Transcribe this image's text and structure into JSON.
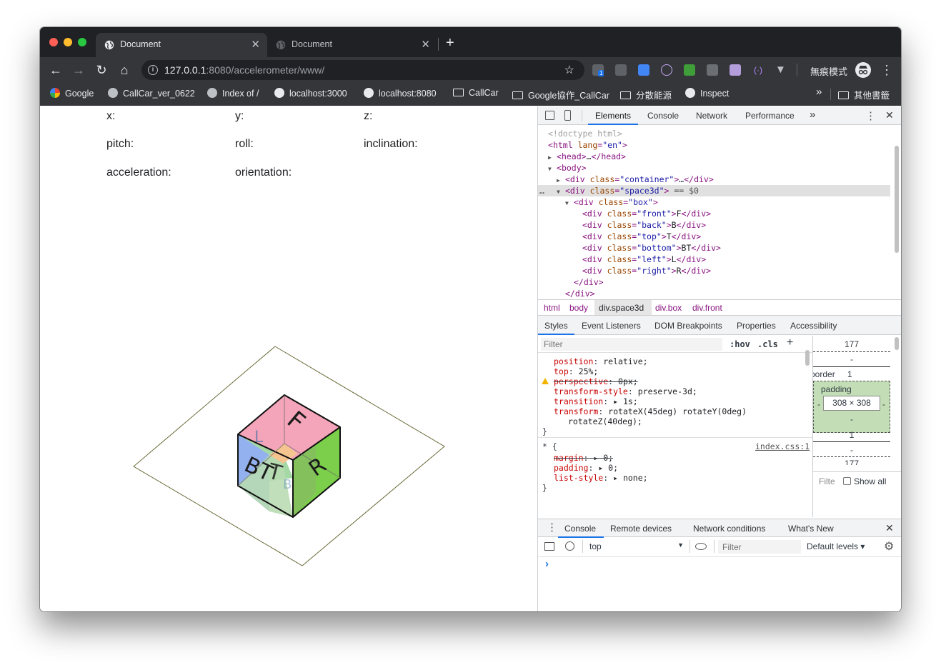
{
  "tabs": [
    {
      "label": "Document",
      "active": true
    },
    {
      "label": "Document",
      "active": false
    }
  ],
  "toolbar": {
    "url_host": "127.0.0.1",
    "url_rest": ":8080/accelerometer/www/",
    "incognito_label": "無痕模式",
    "ext_badge": "1"
  },
  "bookmarks": [
    {
      "label": "Google",
      "icon": "google-icon"
    },
    {
      "label": "CallCar_ver_0622",
      "icon": "site-icon"
    },
    {
      "label": "Index of /",
      "icon": "site-icon"
    },
    {
      "label": "localhost:3000",
      "icon": "globe-icon"
    },
    {
      "label": "localhost:8080",
      "icon": "globe-icon"
    },
    {
      "label": "CallCar",
      "icon": "folder-icon"
    },
    {
      "label": "Google協作_CallCar",
      "icon": "folder-icon"
    },
    {
      "label": "分散能源",
      "icon": "folder-icon"
    },
    {
      "label": "Inspect",
      "icon": "globe-icon"
    }
  ],
  "bookmarks_more": "»",
  "other_bookmarks": "其他書籤",
  "page": {
    "labels": {
      "x": "x:",
      "y": "y:",
      "z": "z:",
      "pitch": "pitch:",
      "roll": "roll:",
      "inclination": "inclination:",
      "acceleration": "acceleration:",
      "orientation": "orientation:"
    },
    "faces": {
      "front": "F",
      "back": "B",
      "top": "T",
      "bottom": "BT",
      "left": "L",
      "right": "R"
    },
    "face_colors": {
      "front": "#f4a5b9",
      "right": "#7ccf4a",
      "left": "#93b0ef",
      "bottom": "#9fd6a0",
      "inner": "#f6c48f"
    }
  },
  "devtools": {
    "tabs": [
      "Elements",
      "Console",
      "Network",
      "Performance"
    ],
    "more": "»",
    "dom": {
      "doctype": "<!doctype html>",
      "html_open": "html",
      "html_lang_attr": "lang",
      "html_lang_val": "\"en\"",
      "head": "head",
      "head_ellipsis": "…",
      "body": "body",
      "container_class": "\"container\"",
      "space3d_class": "\"space3d\"",
      "eq_dollar": " == $0",
      "box_class": "\"box\"",
      "children": [
        {
          "cls": "\"front\"",
          "text": "F"
        },
        {
          "cls": "\"back\"",
          "text": "B"
        },
        {
          "cls": "\"top\"",
          "text": "T"
        },
        {
          "cls": "\"bottom\"",
          "text": "BT"
        },
        {
          "cls": "\"left\"",
          "text": "L"
        },
        {
          "cls": "\"right\"",
          "text": "R"
        }
      ]
    },
    "breadcrumbs": [
      "html",
      "body",
      "div.space3d",
      "div.box",
      "div.front"
    ],
    "subtabs": [
      "Styles",
      "Event Listeners",
      "DOM Breakpoints",
      "Properties",
      "Accessibility"
    ],
    "styles": {
      "filter_placeholder": "Filter",
      "hov": ":hov",
      "cls": ".cls",
      "plus": "+",
      "rules": [
        {
          "prop": "position",
          "val": "relative;"
        },
        {
          "prop": "top",
          "val": "25%;"
        },
        {
          "prop": "perspective",
          "val": "0px;",
          "struck": true,
          "warn": true
        },
        {
          "prop": "transform-style",
          "val": "preserve-3d;"
        },
        {
          "prop": "transition",
          "val": "▸ 1s;"
        },
        {
          "prop": "transform",
          "val": "rotateX(45deg) rotateY(0deg)"
        },
        {
          "prop": "",
          "val": "rotateZ(40deg);"
        }
      ],
      "close_brace": "}",
      "universal_selector": "* {",
      "source": "index.css:1",
      "rules2": [
        {
          "prop": "margin",
          "val": "▸ 0;",
          "struck": true
        },
        {
          "prop": "padding",
          "val": "▸ 0;"
        },
        {
          "prop": "list-style",
          "val": "▸ none;"
        }
      ]
    },
    "boxmodel": {
      "top_value": "177",
      "dash1": "-",
      "border_label": "border",
      "border_value": "1",
      "padding_label": "padding",
      "content_size": "308 × 308",
      "pad_left": "-",
      "pad_right": "-",
      "pad_bottom": "-",
      "border_bottom": "1",
      "dash2": "-",
      "bottom_value": "177",
      "filter": "Filte",
      "show_all": "Show all"
    },
    "drawer_tabs": [
      "Console",
      "Remote devices",
      "Network conditions",
      "What's New"
    ],
    "console": {
      "context": "top",
      "filter_placeholder": "Filter",
      "levels": "Default levels ▾",
      "prompt": "›"
    }
  }
}
